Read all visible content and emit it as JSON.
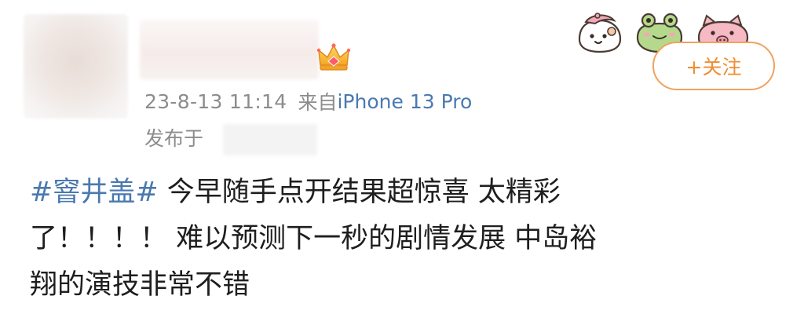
{
  "post": {
    "timestamp": "23-8-13 11:14",
    "source_prefix": "来自",
    "source_device": "iPhone 13 Pro",
    "published_at_label": "发布于",
    "follow_label": "+关注",
    "hashtag": "#窨井盖#",
    "text_line1_rest": "今早随手点开结果超惊喜 太精彩",
    "text_line2": "了！！！！ 难以预测下一秒的剧情发展 中岛裕",
    "text_line3": "翔的演技非常不错"
  },
  "badges": {
    "vip_badge_icon": "crown-icon",
    "sticker_icons": [
      "egg-sticker-icon",
      "frog-sticker-icon",
      "pig-sticker-icon"
    ]
  },
  "colors": {
    "link_blue": "#4a79b0",
    "follow_orange": "#ef8e32",
    "meta_gray": "#8c8c8c",
    "text": "#1e1e1e"
  }
}
